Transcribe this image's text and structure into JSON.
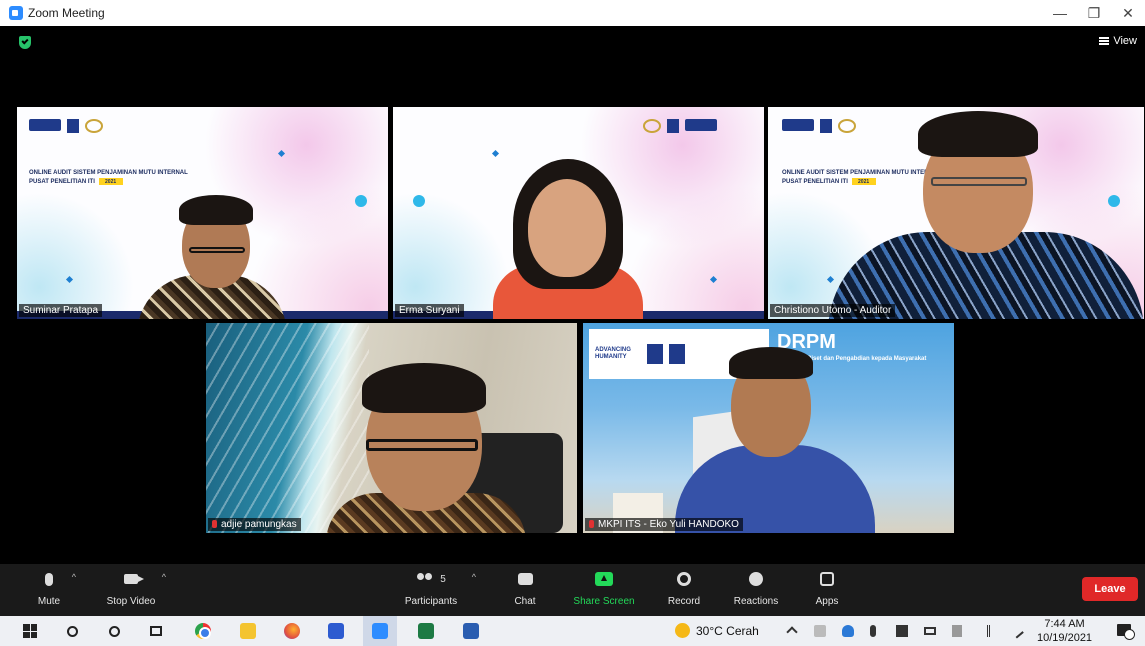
{
  "window": {
    "title": "Zoom Meeting",
    "controls": {
      "minimize": "—",
      "restore": "❐",
      "close": "✕"
    }
  },
  "meeting": {
    "view_label": "View",
    "participants": [
      {
        "name": "Suminar Pratapa",
        "active": false
      },
      {
        "name": "Erma Suryani",
        "active": false
      },
      {
        "name": "Christiono Utomo - Auditor",
        "active": true
      },
      {
        "name": "adjie pamungkas",
        "active": false
      },
      {
        "name": "MKPI ITS - Eko Yuli HANDOKO",
        "active": false
      }
    ],
    "slide": {
      "heading_line1": "ONLINE AUDIT SISTEM PENJAMINAN MUTU INTERNAL",
      "heading_line2": "PUSAT PENELITIAN ITI",
      "year": "2021"
    },
    "drpm": {
      "banner_text": "ADVANCING HUMANITY",
      "title": "DRPM",
      "subtitle": "Direktorat Riset dan Pengabdian kepada Masyarakat"
    }
  },
  "controls": {
    "mute": "Mute",
    "stop_video": "Stop Video",
    "participants": "Participants",
    "participants_count": "5",
    "chat": "Chat",
    "share_screen": "Share Screen",
    "record": "Record",
    "reactions": "Reactions",
    "apps": "Apps",
    "leave": "Leave"
  },
  "taskbar": {
    "weather": "30°C  Cerah",
    "time": "7:44 AM",
    "date": "10/19/2021"
  },
  "colors": {
    "active_speaker": "#c6e05a",
    "share_green": "#23d959",
    "leave_red": "#e02828"
  }
}
